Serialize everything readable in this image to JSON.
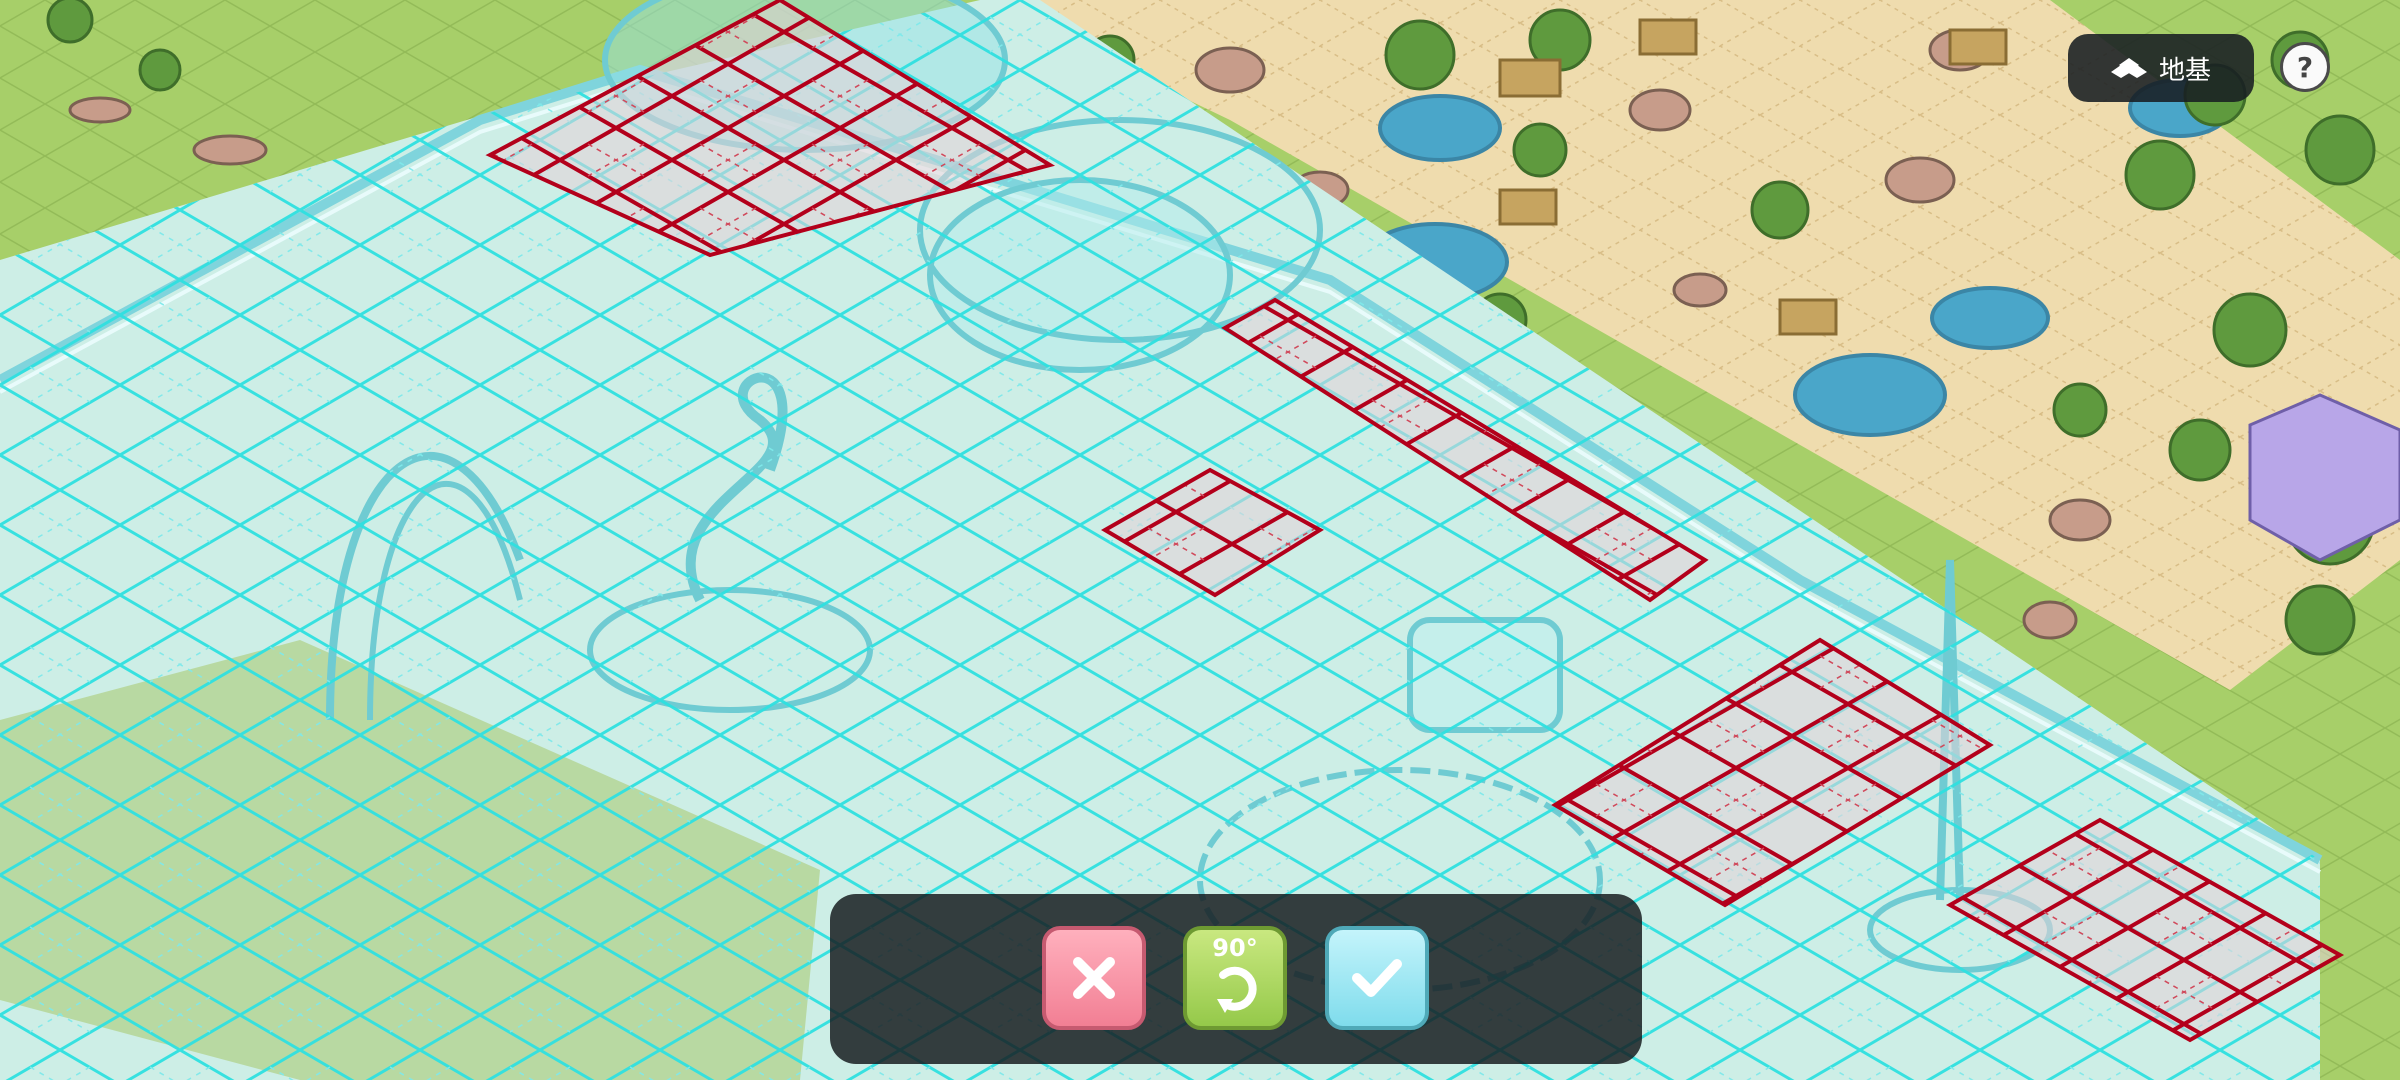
{
  "hud": {
    "foundation_label": "地基",
    "help_label": "?"
  },
  "toolbar": {
    "cancel_icon": "close-icon",
    "rotate_label": "90°",
    "rotate_icon": "rotate-clockwise-icon",
    "confirm_icon": "check-icon"
  },
  "colors": {
    "grid": "#2fe0e0",
    "blocked_tile": "#b3001b",
    "grass": "#a9cf6a",
    "sand": "#efdcae",
    "water": "#4aa6c9",
    "facility_glass": "#c8f0ee"
  }
}
